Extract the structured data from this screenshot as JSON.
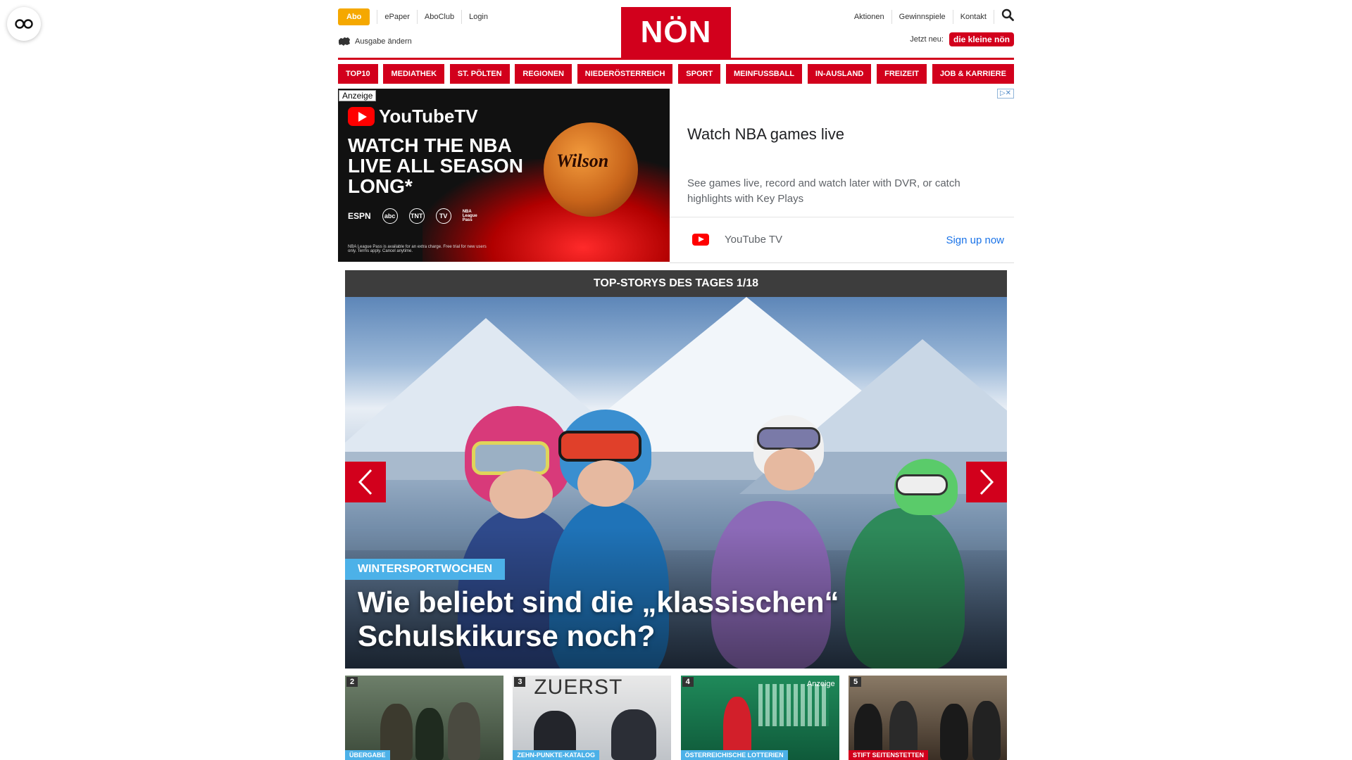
{
  "header": {
    "abo": "Abo",
    "links_left": [
      "ePaper",
      "AboClub",
      "Login"
    ],
    "ausgabe": "Ausgabe ändern",
    "logo": "NÖN",
    "links_right": [
      "Aktionen",
      "Gewinnspiele",
      "Kontakt"
    ],
    "jetzt_neu": "Jetzt neu:",
    "kleine_badge": "die kleine nön"
  },
  "nav": [
    "TOP10",
    "MEDIATHEK",
    "ST. PÖLTEN",
    "REGIONEN",
    "NIEDERÖSTERREICH",
    "SPORT",
    "MEINFUSSBALL",
    "IN-AUSLAND",
    "FREIZEIT",
    "JOB & KARRIERE"
  ],
  "ad": {
    "label": "Anzeige",
    "brand": "YouTubeTV",
    "headline": "WATCH THE NBA LIVE ALL SEASON LONG*",
    "ball_brand": "Wilson",
    "networks": [
      "ESPN",
      "abc",
      "TNT",
      "TV",
      "NBA League Pass"
    ],
    "fine_print": "NBA League Pass is available for an extra charge. Free trial for new users only. Terms apply. Cancel anytime.",
    "title": "Watch NBA games live",
    "description": "See games live, record and watch later with DVR, or catch highlights with Key Plays",
    "advertiser": "YouTube TV",
    "cta": "Sign up now"
  },
  "stories": {
    "bar_title": "TOP-STORYS DES TAGES 1/18",
    "hero_kicker": "WINTERSPORTWOCHEN",
    "hero_title": "Wie beliebt sind die „klassischen“ Schulskikurse noch?",
    "thumbs": [
      {
        "num": "2",
        "category": "ÜBERGABE",
        "ad": ""
      },
      {
        "num": "3",
        "category": "ZEHN-PUNKTE-KATALOG",
        "ad": "",
        "sign": "ZUERST"
      },
      {
        "num": "4",
        "category": "ÖSTERREICHISCHE LOTTERIEN",
        "ad": "Anzeige"
      },
      {
        "num": "5",
        "category": "STIFT SEITENSTETTEN",
        "ad": ""
      }
    ]
  },
  "colors": {
    "brand_red": "#d2001c",
    "abo_orange": "#f5a800",
    "kicker_blue": "#4cb1e8",
    "bar_dark": "#3d3d3d"
  },
  "icons": [
    "reader-glasses-icon",
    "map-icon",
    "search-icon",
    "chevron-left-icon",
    "chevron-right-icon",
    "youtube-icon"
  ]
}
